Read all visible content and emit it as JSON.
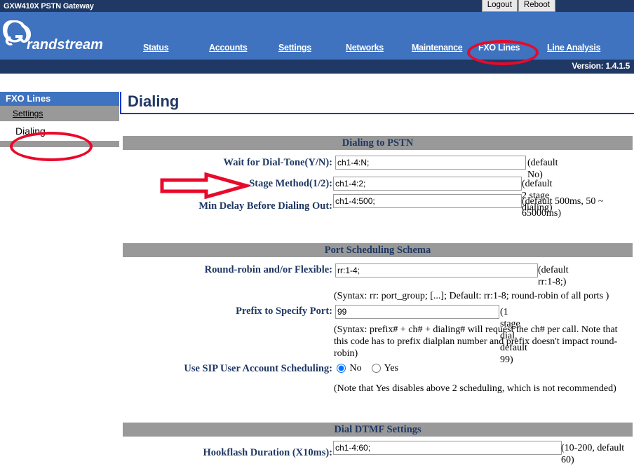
{
  "window": {
    "title": "GXW410X PSTN Gateway",
    "buttons": [
      {
        "label": "Logout"
      },
      {
        "label": "Reboot"
      }
    ]
  },
  "brand": {
    "name": "Grandstream",
    "logo_icon": "grandstream-logo"
  },
  "nav": {
    "items": [
      {
        "label": "Status",
        "active": false
      },
      {
        "label": "Accounts",
        "active": false
      },
      {
        "label": "Settings",
        "active": false
      },
      {
        "label": "Networks",
        "active": false
      },
      {
        "label": "Maintenance",
        "active": false
      },
      {
        "label": "FXO Lines",
        "active": true
      },
      {
        "label": "Line Analysis",
        "active": false
      }
    ],
    "version": "Version: 1.4.1.5"
  },
  "sidebar": {
    "header": "FXO Lines",
    "items": [
      {
        "label": "Settings",
        "active": false
      },
      {
        "label": "Dialing",
        "active": true
      }
    ]
  },
  "page": {
    "title": "Dialing"
  },
  "sections": [
    {
      "id": "dialing-to-pstn",
      "title": "Dialing to PSTN",
      "fields": [
        {
          "label": "Wait for Dial-Tone(Y/N):",
          "value": "ch1-4:N;",
          "hint": "(default No)"
        },
        {
          "label": "Stage Method(1/2):",
          "value": "ch1-4:2;",
          "hint": "(default 2 stage dialing)"
        },
        {
          "label": "Min Delay Before Dialing Out:",
          "value": "ch1-4:500;",
          "hint": "(default 500ms, 50 ~ 65000ms)"
        }
      ]
    },
    {
      "id": "port-scheduling-schema",
      "title": "Port Scheduling Schema",
      "fields": [
        {
          "label": "Round-robin and/or Flexible:",
          "value": "rr:1-4;",
          "hint": "(default rr:1-8;)"
        },
        {
          "label": "Prefix to Specify Port:",
          "value": "99",
          "hint": "(1 stage dial, default 99)"
        }
      ],
      "notes": [
        "(Syntax: rr: port_group; [...]; Default: rr:1-8; round-robin of all ports )",
        "(Syntax: prefix# + ch# + dialing# will request the ch# per call. Note that this code has to prefix dialplan number and prefix doesn't impact round-robin)",
        "(Note that Yes disables above 2 scheduling, which is not recommended)"
      ],
      "radio_field": {
        "label": "Use SIP User Account Scheduling:",
        "options": [
          {
            "label": "No",
            "selected": true
          },
          {
            "label": "Yes",
            "selected": false
          }
        ]
      }
    },
    {
      "id": "dial-dtmf-settings",
      "title": "Dial DTMF Settings",
      "fields": [
        {
          "label": "Hookflash Duration (X10ms):",
          "value": "ch1-4:60;",
          "hint": "(10-200, default 60)"
        }
      ]
    }
  ],
  "annotations": {
    "accent_color": "#e8092b",
    "markers": [
      {
        "type": "ellipse",
        "target": "nav-item-fxo-lines"
      },
      {
        "type": "ellipse",
        "target": "sidebar-item-dialing"
      },
      {
        "type": "arrow",
        "target": "stage-method-field"
      }
    ]
  },
  "colors": {
    "titlebar": "#1f3864",
    "banner": "#3f72bf",
    "section_bar": "#999999",
    "label_text": "#1f3864",
    "title_rule": "#1438c8"
  }
}
